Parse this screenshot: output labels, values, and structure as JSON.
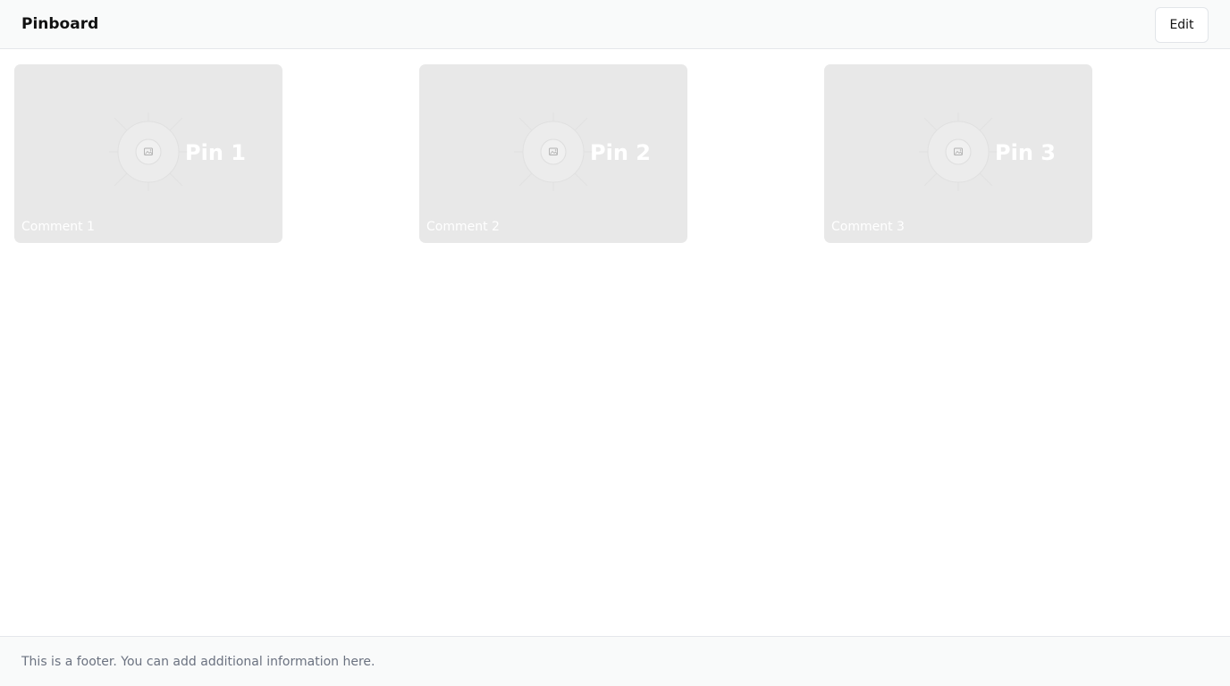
{
  "header": {
    "title": "Pinboard",
    "edit_label": "Edit"
  },
  "pins": [
    {
      "title": "Pin 1",
      "comment": "Comment 1",
      "image_icon": "image-icon"
    },
    {
      "title": "Pin 2",
      "comment": "Comment 2",
      "image_icon": "image-icon"
    },
    {
      "title": "Pin 3",
      "comment": "Comment 3",
      "image_icon": "image-icon"
    }
  ],
  "footer": {
    "text": "This is a footer. You can add additional information here."
  },
  "colors": {
    "card_background": "#e8e8e8",
    "header_background": "#f9fafa",
    "footer_text": "#6b7280"
  }
}
